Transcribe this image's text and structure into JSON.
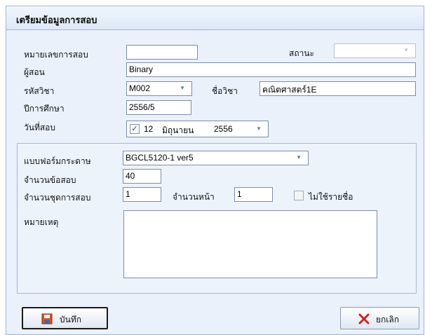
{
  "header": {
    "title": "เตรียมข้อมูลการสอบ"
  },
  "form": {
    "exam_no": {
      "label": "หมายเลขการสอบ",
      "value": ""
    },
    "status": {
      "label": "สถานะ",
      "value": ""
    },
    "instructor": {
      "label": "ผู้สอน",
      "value": "Binary"
    },
    "course_code": {
      "label": "รหัสวิชา",
      "value": "M002"
    },
    "course_name": {
      "label": "ชื่อวิชา",
      "value": "คณิตศาสตร์1E"
    },
    "academic_year": {
      "label": "ปีการศึกษา",
      "value": "2556/5"
    },
    "exam_date": {
      "label": "วันที่สอบ",
      "day": "12",
      "month": "มิถุนายน",
      "year": "2556",
      "checked": true
    }
  },
  "sheet": {
    "form_type": {
      "label": "แบบฟอร์มกระดาษ",
      "value": "BGCL5120-1 ver5"
    },
    "question_count": {
      "label": "จำนวนข้อสอบ",
      "value": "40"
    },
    "set_count": {
      "label": "จำนวนชุดการสอบ",
      "value": "1"
    },
    "page_count": {
      "label": "จำนวนหน้า",
      "value": "1"
    },
    "no_name_list": {
      "label": "ไม่ใช้รายชื่อ",
      "checked": false
    },
    "remark": {
      "label": "หมายเหตุ",
      "value": ""
    }
  },
  "buttons": {
    "save": "บันทึก",
    "cancel": "ยกเลิก"
  },
  "icons": {
    "save": "save-disk-icon",
    "cancel": "red-x-icon",
    "dropdown": "chevron-down-icon"
  }
}
